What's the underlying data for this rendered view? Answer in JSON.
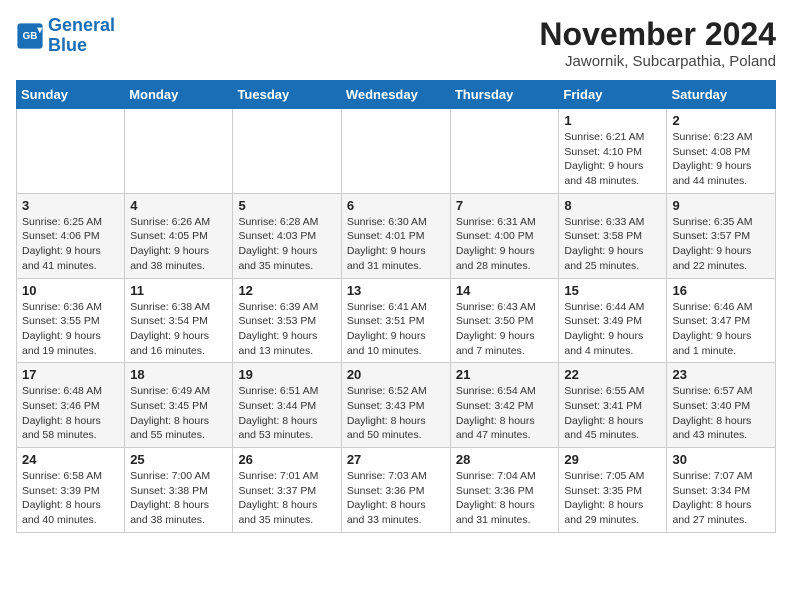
{
  "logo": {
    "line1": "General",
    "line2": "Blue"
  },
  "title": "November 2024",
  "location": "Jawornik, Subcarpathia, Poland",
  "days_header": [
    "Sunday",
    "Monday",
    "Tuesday",
    "Wednesday",
    "Thursday",
    "Friday",
    "Saturday"
  ],
  "weeks": [
    [
      {
        "day": "",
        "info": ""
      },
      {
        "day": "",
        "info": ""
      },
      {
        "day": "",
        "info": ""
      },
      {
        "day": "",
        "info": ""
      },
      {
        "day": "",
        "info": ""
      },
      {
        "day": "1",
        "info": "Sunrise: 6:21 AM\nSunset: 4:10 PM\nDaylight: 9 hours\nand 48 minutes."
      },
      {
        "day": "2",
        "info": "Sunrise: 6:23 AM\nSunset: 4:08 PM\nDaylight: 9 hours\nand 44 minutes."
      }
    ],
    [
      {
        "day": "3",
        "info": "Sunrise: 6:25 AM\nSunset: 4:06 PM\nDaylight: 9 hours\nand 41 minutes."
      },
      {
        "day": "4",
        "info": "Sunrise: 6:26 AM\nSunset: 4:05 PM\nDaylight: 9 hours\nand 38 minutes."
      },
      {
        "day": "5",
        "info": "Sunrise: 6:28 AM\nSunset: 4:03 PM\nDaylight: 9 hours\nand 35 minutes."
      },
      {
        "day": "6",
        "info": "Sunrise: 6:30 AM\nSunset: 4:01 PM\nDaylight: 9 hours\nand 31 minutes."
      },
      {
        "day": "7",
        "info": "Sunrise: 6:31 AM\nSunset: 4:00 PM\nDaylight: 9 hours\nand 28 minutes."
      },
      {
        "day": "8",
        "info": "Sunrise: 6:33 AM\nSunset: 3:58 PM\nDaylight: 9 hours\nand 25 minutes."
      },
      {
        "day": "9",
        "info": "Sunrise: 6:35 AM\nSunset: 3:57 PM\nDaylight: 9 hours\nand 22 minutes."
      }
    ],
    [
      {
        "day": "10",
        "info": "Sunrise: 6:36 AM\nSunset: 3:55 PM\nDaylight: 9 hours\nand 19 minutes."
      },
      {
        "day": "11",
        "info": "Sunrise: 6:38 AM\nSunset: 3:54 PM\nDaylight: 9 hours\nand 16 minutes."
      },
      {
        "day": "12",
        "info": "Sunrise: 6:39 AM\nSunset: 3:53 PM\nDaylight: 9 hours\nand 13 minutes."
      },
      {
        "day": "13",
        "info": "Sunrise: 6:41 AM\nSunset: 3:51 PM\nDaylight: 9 hours\nand 10 minutes."
      },
      {
        "day": "14",
        "info": "Sunrise: 6:43 AM\nSunset: 3:50 PM\nDaylight: 9 hours\nand 7 minutes."
      },
      {
        "day": "15",
        "info": "Sunrise: 6:44 AM\nSunset: 3:49 PM\nDaylight: 9 hours\nand 4 minutes."
      },
      {
        "day": "16",
        "info": "Sunrise: 6:46 AM\nSunset: 3:47 PM\nDaylight: 9 hours\nand 1 minute."
      }
    ],
    [
      {
        "day": "17",
        "info": "Sunrise: 6:48 AM\nSunset: 3:46 PM\nDaylight: 8 hours\nand 58 minutes."
      },
      {
        "day": "18",
        "info": "Sunrise: 6:49 AM\nSunset: 3:45 PM\nDaylight: 8 hours\nand 55 minutes."
      },
      {
        "day": "19",
        "info": "Sunrise: 6:51 AM\nSunset: 3:44 PM\nDaylight: 8 hours\nand 53 minutes."
      },
      {
        "day": "20",
        "info": "Sunrise: 6:52 AM\nSunset: 3:43 PM\nDaylight: 8 hours\nand 50 minutes."
      },
      {
        "day": "21",
        "info": "Sunrise: 6:54 AM\nSunset: 3:42 PM\nDaylight: 8 hours\nand 47 minutes."
      },
      {
        "day": "22",
        "info": "Sunrise: 6:55 AM\nSunset: 3:41 PM\nDaylight: 8 hours\nand 45 minutes."
      },
      {
        "day": "23",
        "info": "Sunrise: 6:57 AM\nSunset: 3:40 PM\nDaylight: 8 hours\nand 43 minutes."
      }
    ],
    [
      {
        "day": "24",
        "info": "Sunrise: 6:58 AM\nSunset: 3:39 PM\nDaylight: 8 hours\nand 40 minutes."
      },
      {
        "day": "25",
        "info": "Sunrise: 7:00 AM\nSunset: 3:38 PM\nDaylight: 8 hours\nand 38 minutes."
      },
      {
        "day": "26",
        "info": "Sunrise: 7:01 AM\nSunset: 3:37 PM\nDaylight: 8 hours\nand 35 minutes."
      },
      {
        "day": "27",
        "info": "Sunrise: 7:03 AM\nSunset: 3:36 PM\nDaylight: 8 hours\nand 33 minutes."
      },
      {
        "day": "28",
        "info": "Sunrise: 7:04 AM\nSunset: 3:36 PM\nDaylight: 8 hours\nand 31 minutes."
      },
      {
        "day": "29",
        "info": "Sunrise: 7:05 AM\nSunset: 3:35 PM\nDaylight: 8 hours\nand 29 minutes."
      },
      {
        "day": "30",
        "info": "Sunrise: 7:07 AM\nSunset: 3:34 PM\nDaylight: 8 hours\nand 27 minutes."
      }
    ]
  ]
}
